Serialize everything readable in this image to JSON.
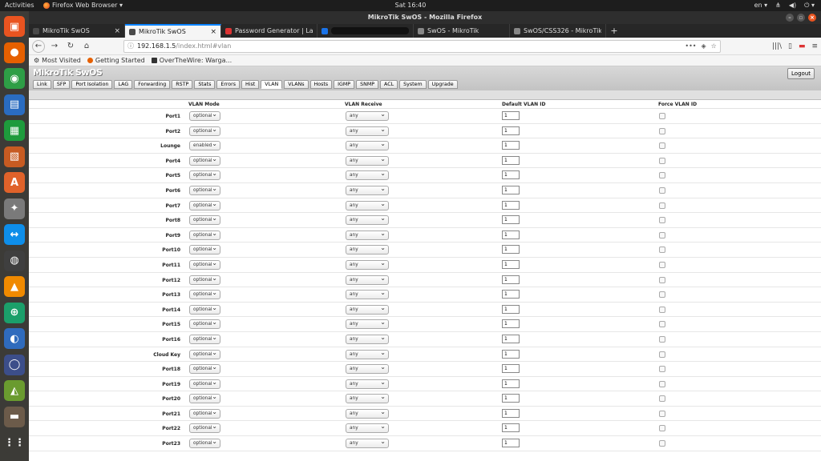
{
  "topbar": {
    "activities": "Activities",
    "app_menu": "Firefox Web Browser ▾",
    "clock": "Sat 16:40",
    "lang": "en ▾",
    "network": "⋔",
    "volume": "◀)",
    "power": "⏻ ▾"
  },
  "window": {
    "title": "MikroTik SwOS - Mozilla Firefox"
  },
  "tabs": [
    {
      "title": "MikroTik SwOS",
      "favicon_color": "#4a4a4a",
      "active": false
    },
    {
      "title": "MikroTik SwOS",
      "favicon_color": "#4a4a4a",
      "active": true
    },
    {
      "title": "Password Generator | La",
      "favicon_color": "#d33",
      "active": false
    },
    {
      "title": "",
      "favicon_color": "#1a73e8",
      "active": false,
      "redacted": true
    },
    {
      "title": "SwOS - MikroTik",
      "favicon_color": "#888",
      "active": false
    },
    {
      "title": "SwOS/CSS326 - MikroTik W",
      "favicon_color": "#888",
      "active": false
    }
  ],
  "url": {
    "host": "192.168.1.5",
    "path": "/index.html#vlan"
  },
  "bookmarks": [
    {
      "label": "Most Visited",
      "icon": "gear-icon"
    },
    {
      "label": "Getting Started",
      "icon": "firefox-icon"
    },
    {
      "label": "OverTheWire: Warga...",
      "icon": "otw-icon"
    }
  ],
  "swos": {
    "logo": "MikroTik SwOS",
    "logout": "Logout",
    "tabs": [
      "Link",
      "SFP",
      "Port Isolation",
      "LAG",
      "Forwarding",
      "RSTP",
      "Stats",
      "Errors",
      "Hist",
      "VLAN",
      "VLANs",
      "Hosts",
      "IGMP",
      "SNMP",
      "ACL",
      "System",
      "Upgrade"
    ],
    "active_tab": "VLAN",
    "columns": [
      "VLAN Mode",
      "VLAN Receive",
      "Default VLAN ID",
      "Force VLAN ID"
    ],
    "rows": [
      {
        "port": "Port1",
        "mode": "optional",
        "receive": "any",
        "vid": "1"
      },
      {
        "port": "Port2",
        "mode": "optional",
        "receive": "any",
        "vid": "1"
      },
      {
        "port": "Lounge",
        "mode": "enabled",
        "receive": "any",
        "vid": "1"
      },
      {
        "port": "Port4",
        "mode": "optional",
        "receive": "any",
        "vid": "1"
      },
      {
        "port": "Port5",
        "mode": "optional",
        "receive": "any",
        "vid": "1"
      },
      {
        "port": "Port6",
        "mode": "optional",
        "receive": "any",
        "vid": "1"
      },
      {
        "port": "Port7",
        "mode": "optional",
        "receive": "any",
        "vid": "1"
      },
      {
        "port": "Port8",
        "mode": "optional",
        "receive": "any",
        "vid": "1"
      },
      {
        "port": "Port9",
        "mode": "optional",
        "receive": "any",
        "vid": "1"
      },
      {
        "port": "Port10",
        "mode": "optional",
        "receive": "any",
        "vid": "1"
      },
      {
        "port": "Port11",
        "mode": "optional",
        "receive": "any",
        "vid": "1"
      },
      {
        "port": "Port12",
        "mode": "optional",
        "receive": "any",
        "vid": "1"
      },
      {
        "port": "Port13",
        "mode": "optional",
        "receive": "any",
        "vid": "1"
      },
      {
        "port": "Port14",
        "mode": "optional",
        "receive": "any",
        "vid": "1"
      },
      {
        "port": "Port15",
        "mode": "optional",
        "receive": "any",
        "vid": "1"
      },
      {
        "port": "Port16",
        "mode": "optional",
        "receive": "any",
        "vid": "1"
      },
      {
        "port": "Cloud Key",
        "mode": "optional",
        "receive": "any",
        "vid": "1"
      },
      {
        "port": "Port18",
        "mode": "optional",
        "receive": "any",
        "vid": "1"
      },
      {
        "port": "Port19",
        "mode": "optional",
        "receive": "any",
        "vid": "1"
      },
      {
        "port": "Port20",
        "mode": "optional",
        "receive": "any",
        "vid": "1"
      },
      {
        "port": "Port21",
        "mode": "optional",
        "receive": "any",
        "vid": "1"
      },
      {
        "port": "Port22",
        "mode": "optional",
        "receive": "any",
        "vid": "1"
      },
      {
        "port": "Port23",
        "mode": "optional",
        "receive": "any",
        "vid": "1"
      }
    ]
  },
  "dock": [
    {
      "name": "files-icon",
      "color": "#e95420",
      "glyph": "▣"
    },
    {
      "name": "firefox-icon",
      "color": "#e66000",
      "glyph": "●"
    },
    {
      "name": "chrome-icon",
      "color": "#2e9e46",
      "glyph": "◉"
    },
    {
      "name": "writer-icon",
      "color": "#2a6cc0",
      "glyph": "▤"
    },
    {
      "name": "calc-icon",
      "color": "#1e9b3c",
      "glyph": "▦"
    },
    {
      "name": "impress-icon",
      "color": "#c75b22",
      "glyph": "▧"
    },
    {
      "name": "software-icon",
      "color": "#e0622a",
      "glyph": "A"
    },
    {
      "name": "settings-icon",
      "color": "#7a7a7a",
      "glyph": "✦"
    },
    {
      "name": "teamviewer-icon",
      "color": "#0e8ee9",
      "glyph": "↔"
    },
    {
      "name": "wireshark-icon",
      "color": "#3f3f3f",
      "glyph": "◍"
    },
    {
      "name": "vlc-icon",
      "color": "#f08a00",
      "glyph": "▲"
    },
    {
      "name": "gitkraken-icon",
      "color": "#1b9f6a",
      "glyph": "⊕"
    },
    {
      "name": "bird-icon",
      "color": "#2f6bbd",
      "glyph": "◐"
    },
    {
      "name": "eclipse-icon",
      "color": "#3c4e8a",
      "glyph": "◯"
    },
    {
      "name": "android-icon",
      "color": "#6a9b2f",
      "glyph": "◭"
    },
    {
      "name": "tool-icon",
      "color": "#6c5b4a",
      "glyph": "▬"
    },
    {
      "name": "app-grid-icon",
      "color": "#3c3b37",
      "glyph": "⋮⋮"
    }
  ]
}
